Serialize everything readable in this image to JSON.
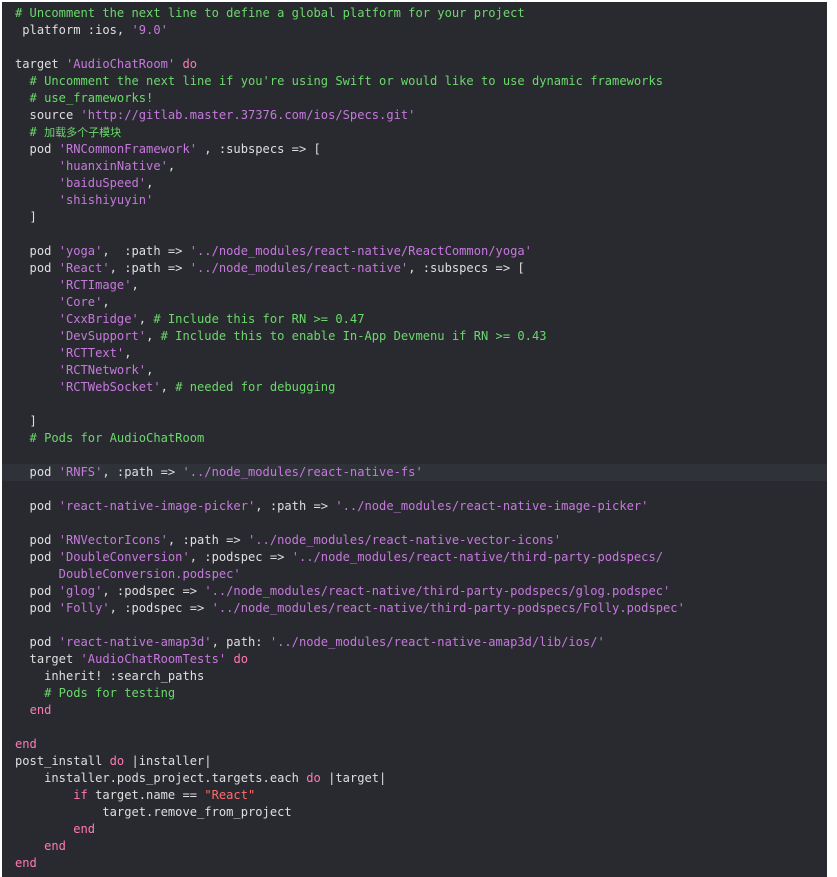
{
  "lines": [
    {
      "tokens": [
        {
          "t": "# Uncomment the next line to define a global platform for your project",
          "c": "comment"
        }
      ]
    },
    {
      "tokens": [
        {
          "t": " platform :ios, ",
          "c": "plain"
        },
        {
          "t": "'9.0'",
          "c": "string"
        }
      ]
    },
    {
      "tokens": []
    },
    {
      "tokens": [
        {
          "t": "target ",
          "c": "plain"
        },
        {
          "t": "'AudioChatRoom'",
          "c": "string"
        },
        {
          "t": " ",
          "c": "plain"
        },
        {
          "t": "do",
          "c": "keyword"
        }
      ]
    },
    {
      "tokens": [
        {
          "t": "  # Uncomment the next line if you're using Swift or would like to use dynamic frameworks",
          "c": "comment"
        }
      ]
    },
    {
      "tokens": [
        {
          "t": "  # use_frameworks!",
          "c": "comment"
        }
      ]
    },
    {
      "tokens": [
        {
          "t": "  source ",
          "c": "plain"
        },
        {
          "t": "'http://gitlab.master.37376.com/ios/Specs.git'",
          "c": "string"
        }
      ]
    },
    {
      "tokens": [
        {
          "t": "  # ",
          "c": "comment"
        },
        {
          "t": "加载多个子模块",
          "c": "comment cjk"
        }
      ]
    },
    {
      "tokens": [
        {
          "t": "  pod ",
          "c": "plain"
        },
        {
          "t": "'RNCommonFramework'",
          "c": "string"
        },
        {
          "t": " , :subspecs => [",
          "c": "plain"
        }
      ]
    },
    {
      "tokens": [
        {
          "t": "      ",
          "c": "plain"
        },
        {
          "t": "'huanxinNative'",
          "c": "string"
        },
        {
          "t": ",",
          "c": "plain"
        }
      ]
    },
    {
      "tokens": [
        {
          "t": "      ",
          "c": "plain"
        },
        {
          "t": "'baiduSpeed'",
          "c": "string"
        },
        {
          "t": ",",
          "c": "plain"
        }
      ]
    },
    {
      "tokens": [
        {
          "t": "      ",
          "c": "plain"
        },
        {
          "t": "'shishiyuyin'",
          "c": "string"
        }
      ]
    },
    {
      "tokens": [
        {
          "t": "  ]",
          "c": "plain"
        }
      ]
    },
    {
      "tokens": []
    },
    {
      "tokens": [
        {
          "t": "  pod ",
          "c": "plain"
        },
        {
          "t": "'yoga'",
          "c": "string"
        },
        {
          "t": ",  :path => ",
          "c": "plain"
        },
        {
          "t": "'../node_modules/react-native/ReactCommon/yoga'",
          "c": "string"
        }
      ]
    },
    {
      "tokens": [
        {
          "t": "  pod ",
          "c": "plain"
        },
        {
          "t": "'React'",
          "c": "string"
        },
        {
          "t": ", :path => ",
          "c": "plain"
        },
        {
          "t": "'../node_modules/react-native'",
          "c": "string"
        },
        {
          "t": ", :subspecs => [",
          "c": "plain"
        }
      ]
    },
    {
      "tokens": [
        {
          "t": "      ",
          "c": "plain"
        },
        {
          "t": "'RCTImage'",
          "c": "string"
        },
        {
          "t": ",",
          "c": "plain"
        }
      ]
    },
    {
      "tokens": [
        {
          "t": "      ",
          "c": "plain"
        },
        {
          "t": "'Core'",
          "c": "string"
        },
        {
          "t": ",",
          "c": "plain"
        }
      ]
    },
    {
      "tokens": [
        {
          "t": "      ",
          "c": "plain"
        },
        {
          "t": "'CxxBridge'",
          "c": "string"
        },
        {
          "t": ", ",
          "c": "plain"
        },
        {
          "t": "# Include this for RN >= 0.47",
          "c": "comment"
        }
      ]
    },
    {
      "tokens": [
        {
          "t": "      ",
          "c": "plain"
        },
        {
          "t": "'DevSupport'",
          "c": "string"
        },
        {
          "t": ", ",
          "c": "plain"
        },
        {
          "t": "# Include this to enable In-App Devmenu if RN >= 0.43",
          "c": "comment"
        }
      ]
    },
    {
      "tokens": [
        {
          "t": "      ",
          "c": "plain"
        },
        {
          "t": "'RCTText'",
          "c": "string"
        },
        {
          "t": ",",
          "c": "plain"
        }
      ]
    },
    {
      "tokens": [
        {
          "t": "      ",
          "c": "plain"
        },
        {
          "t": "'RCTNetwork'",
          "c": "string"
        },
        {
          "t": ",",
          "c": "plain"
        }
      ]
    },
    {
      "tokens": [
        {
          "t": "      ",
          "c": "plain"
        },
        {
          "t": "'RCTWebSocket'",
          "c": "string"
        },
        {
          "t": ", ",
          "c": "plain"
        },
        {
          "t": "# needed for debugging",
          "c": "comment"
        }
      ]
    },
    {
      "tokens": []
    },
    {
      "tokens": [
        {
          "t": "  ]",
          "c": "plain"
        }
      ]
    },
    {
      "tokens": [
        {
          "t": "  # Pods for AudioChatRoom",
          "c": "comment"
        }
      ]
    },
    {
      "tokens": []
    },
    {
      "highlight": true,
      "tokens": [
        {
          "t": "  pod ",
          "c": "plain"
        },
        {
          "t": "'RNFS'",
          "c": "string"
        },
        {
          "t": ", :path => ",
          "c": "plain"
        },
        {
          "t": "'../node_modules/react-native-fs'",
          "c": "string"
        }
      ]
    },
    {
      "tokens": []
    },
    {
      "tokens": [
        {
          "t": "  pod ",
          "c": "plain"
        },
        {
          "t": "'react-native-image-picker'",
          "c": "string"
        },
        {
          "t": ", :path => ",
          "c": "plain"
        },
        {
          "t": "'../node_modules/react-native-image-picker'",
          "c": "string"
        }
      ]
    },
    {
      "tokens": []
    },
    {
      "tokens": [
        {
          "t": "  pod ",
          "c": "plain"
        },
        {
          "t": "'RNVectorIcons'",
          "c": "string"
        },
        {
          "t": ", :path => ",
          "c": "plain"
        },
        {
          "t": "'../node_modules/react-native-vector-icons'",
          "c": "string"
        }
      ]
    },
    {
      "tokens": [
        {
          "t": "  pod ",
          "c": "plain"
        },
        {
          "t": "'DoubleConversion'",
          "c": "string"
        },
        {
          "t": ", :podspec => ",
          "c": "plain"
        },
        {
          "t": "'../node_modules/react-native/third-party-podspecs/",
          "c": "string"
        }
      ]
    },
    {
      "tokens": [
        {
          "t": "      DoubleConversion.podspec'",
          "c": "string"
        }
      ]
    },
    {
      "tokens": [
        {
          "t": "  pod ",
          "c": "plain"
        },
        {
          "t": "'glog'",
          "c": "string"
        },
        {
          "t": ", :podspec => ",
          "c": "plain"
        },
        {
          "t": "'../node_modules/react-native/third-party-podspecs/glog.podspec'",
          "c": "string"
        }
      ]
    },
    {
      "tokens": [
        {
          "t": "  pod ",
          "c": "plain"
        },
        {
          "t": "'Folly'",
          "c": "string"
        },
        {
          "t": ", :podspec => ",
          "c": "plain"
        },
        {
          "t": "'../node_modules/react-native/third-party-podspecs/Folly.podspec'",
          "c": "string"
        }
      ]
    },
    {
      "tokens": []
    },
    {
      "tokens": [
        {
          "t": "  pod ",
          "c": "plain"
        },
        {
          "t": "'react-native-amap3d'",
          "c": "string"
        },
        {
          "t": ", path: ",
          "c": "plain"
        },
        {
          "t": "'../node_modules/react-native-amap3d/lib/ios/'",
          "c": "string"
        }
      ]
    },
    {
      "tokens": [
        {
          "t": "  target ",
          "c": "plain"
        },
        {
          "t": "'AudioChatRoomTests'",
          "c": "string"
        },
        {
          "t": " ",
          "c": "plain"
        },
        {
          "t": "do",
          "c": "keyword"
        }
      ]
    },
    {
      "tokens": [
        {
          "t": "    inherit! :search_paths",
          "c": "plain"
        }
      ]
    },
    {
      "tokens": [
        {
          "t": "    # Pods for testing",
          "c": "comment"
        }
      ]
    },
    {
      "tokens": [
        {
          "t": "  ",
          "c": "plain"
        },
        {
          "t": "end",
          "c": "keyword"
        }
      ]
    },
    {
      "tokens": []
    },
    {
      "tokens": [
        {
          "t": "end",
          "c": "keyword"
        }
      ]
    },
    {
      "tokens": [
        {
          "t": "post_install ",
          "c": "plain"
        },
        {
          "t": "do",
          "c": "keyword"
        },
        {
          "t": " |installer|",
          "c": "plain"
        }
      ]
    },
    {
      "tokens": [
        {
          "t": "    installer.pods_project.targets.each ",
          "c": "plain"
        },
        {
          "t": "do",
          "c": "keyword"
        },
        {
          "t": " |target|",
          "c": "plain"
        }
      ]
    },
    {
      "tokens": [
        {
          "t": "        ",
          "c": "plain"
        },
        {
          "t": "if",
          "c": "keyword"
        },
        {
          "t": " target.name == ",
          "c": "plain"
        },
        {
          "t": "\"React\"",
          "c": "string red"
        }
      ]
    },
    {
      "tokens": [
        {
          "t": "            target.remove_from_project",
          "c": "plain"
        }
      ]
    },
    {
      "tokens": [
        {
          "t": "        ",
          "c": "plain"
        },
        {
          "t": "end",
          "c": "keyword"
        }
      ]
    },
    {
      "tokens": [
        {
          "t": "    ",
          "c": "plain"
        },
        {
          "t": "end",
          "c": "keyword"
        }
      ]
    },
    {
      "tokens": [
        {
          "t": "end",
          "c": "keyword"
        }
      ]
    }
  ]
}
